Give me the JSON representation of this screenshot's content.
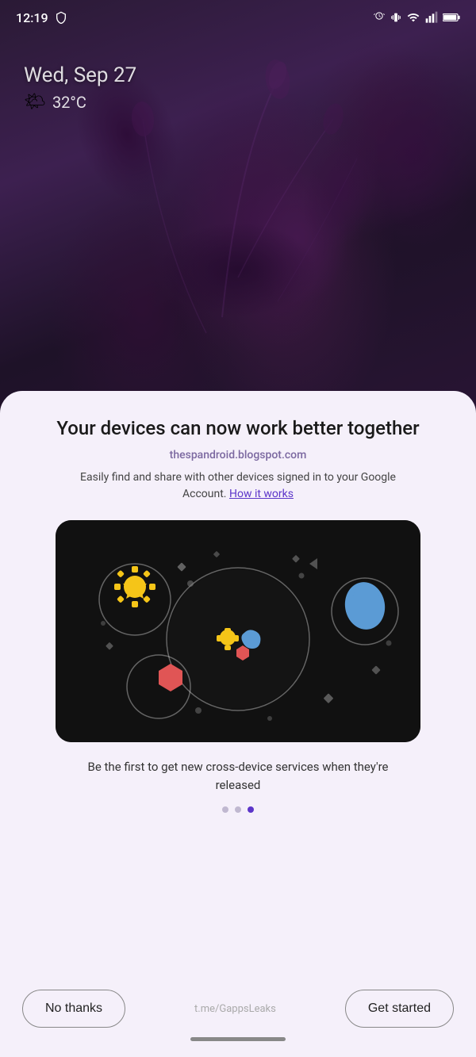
{
  "status_bar": {
    "time": "12:19",
    "icons": [
      "alarm",
      "vibrate",
      "wifi",
      "signal",
      "battery"
    ]
  },
  "lockscreen": {
    "date": "Wed, Sep 27",
    "weather_icon": "🌤️",
    "temperature": "32°C"
  },
  "dialog": {
    "title": "Your devices can now work better together",
    "subtitle": "thespandroid.blogspot.com",
    "description": "Easily find and share with other devices signed in to your Google Account.",
    "how_it_works_link": "How it works",
    "caption": "Be the first to get new cross-device services when they're released",
    "dots": [
      {
        "active": false
      },
      {
        "active": false
      },
      {
        "active": true
      }
    ]
  },
  "buttons": {
    "no_thanks": "No thanks",
    "watermark": "t.me/GappsLeaks",
    "get_started": "Get started"
  },
  "colors": {
    "accent": "#5c35c9",
    "subtitle": "#7b68a0",
    "background": "#f5f0fa",
    "dot_inactive": "#c0b8d0",
    "dot_active": "#5c35c9"
  }
}
